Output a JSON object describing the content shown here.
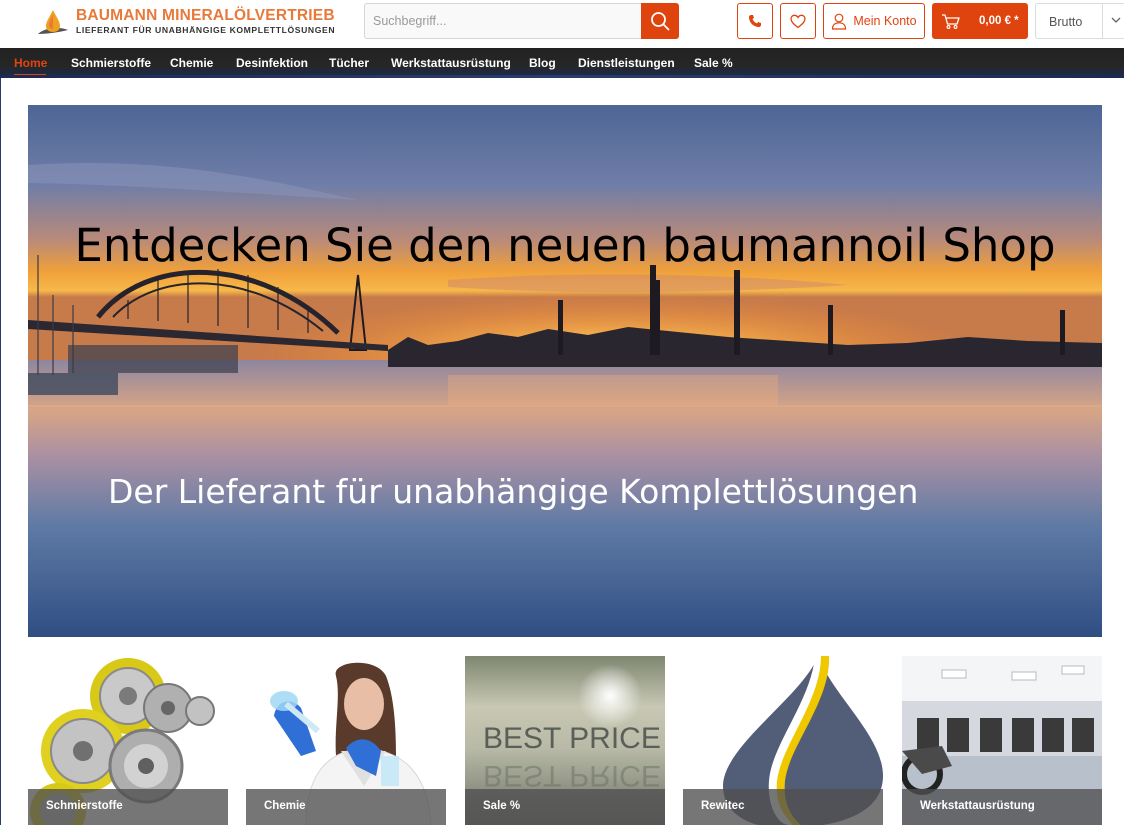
{
  "header": {
    "logo_title": "BAUMANN MINERALÖLVERTRIEB",
    "logo_subtitle": "LIEFERANT FÜR UNABHÄNGIGE KOMPLETTLÖSUNGEN",
    "search_placeholder": "Suchbegriff...",
    "account_label": "Mein Konto",
    "cart_label": "0,00 € *",
    "tax_mode": "Brutto",
    "icons": [
      "search-icon",
      "phone-icon",
      "heart-icon",
      "user-icon",
      "cart-icon",
      "chevron-down-icon"
    ],
    "accent_color": "#e0440e"
  },
  "nav": {
    "items": [
      {
        "label": "Home",
        "active": true
      },
      {
        "label": "Schmierstoffe"
      },
      {
        "label": "Chemie"
      },
      {
        "label": "Desinfektion"
      },
      {
        "label": "Tücher"
      },
      {
        "label": "Werkstattausrüstung"
      },
      {
        "label": "Blog"
      },
      {
        "label": "Dienstleistungen"
      },
      {
        "label": "Sale %"
      }
    ]
  },
  "hero": {
    "title": "Entdecken Sie den neuen baumannoil Shop",
    "subtitle": "Der Lieferant für unabhängige Komplettlösungen"
  },
  "categories": [
    {
      "label": "Schmierstoffe"
    },
    {
      "label": "Chemie"
    },
    {
      "label": "Sale %",
      "image_text": "BEST PRICE"
    },
    {
      "label": "Rewitec"
    },
    {
      "label": "Werkstattausrüstung"
    }
  ]
}
